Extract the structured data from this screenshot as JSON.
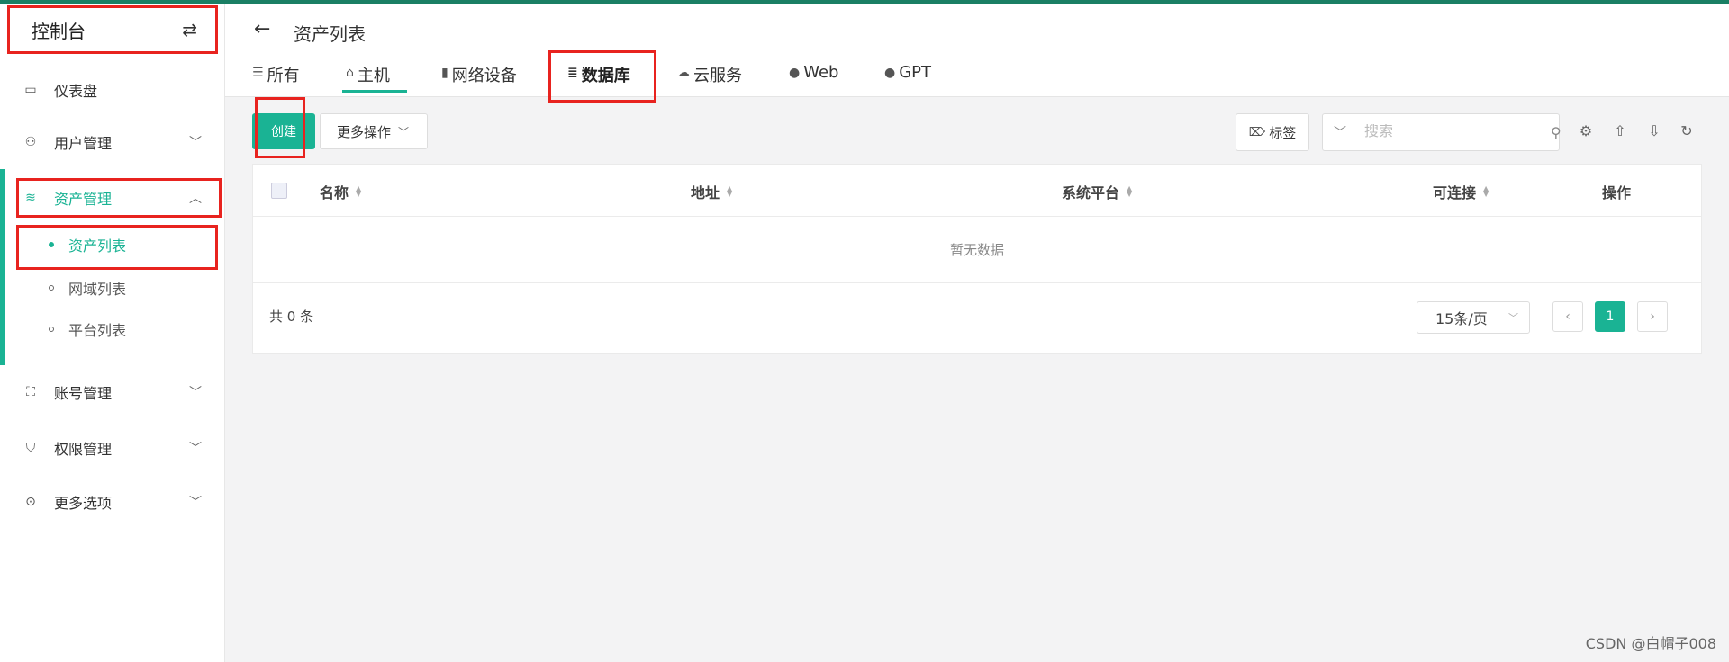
{
  "sidebar": {
    "console_title": "控制台",
    "swap_icon": "⇄",
    "items": [
      {
        "label": "仪表盘"
      },
      {
        "label": "用户管理"
      },
      {
        "label": "资产管理"
      },
      {
        "label": "账号管理"
      },
      {
        "label": "权限管理"
      },
      {
        "label": "更多选项"
      }
    ],
    "sub_items": [
      {
        "label": "资产列表"
      },
      {
        "label": "网域列表"
      },
      {
        "label": "平台列表"
      }
    ]
  },
  "header": {
    "title": "资产列表",
    "tabs": [
      {
        "label": "所有",
        "icon": "list-icon"
      },
      {
        "label": "主机",
        "icon": "host-icon"
      },
      {
        "label": "网络设备",
        "icon": "device-icon"
      },
      {
        "label": "数据库",
        "icon": "database-icon"
      },
      {
        "label": "云服务",
        "icon": "cloud-icon"
      },
      {
        "label": "Web",
        "icon": "globe-icon"
      },
      {
        "label": "GPT",
        "icon": "chat-icon"
      }
    ]
  },
  "toolbar": {
    "create_label": "创建",
    "more_label": "更多操作",
    "tag_label": "标签",
    "search_placeholder": "搜索"
  },
  "table": {
    "columns": [
      "名称",
      "地址",
      "系统平台",
      "可连接",
      "操作"
    ],
    "empty_text": "暂无数据",
    "total_text": "共 0 条",
    "page_size": "15条/页",
    "current_page": "1"
  },
  "watermark": "CSDN @白帽子008",
  "colors": {
    "accent": "#1ab394",
    "highlight_box": "#e8231f",
    "top_line": "#1a7f64"
  }
}
